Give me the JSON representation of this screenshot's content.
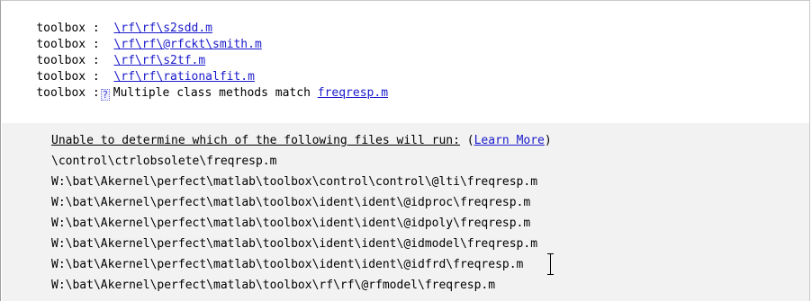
{
  "results": [
    {
      "label": "toolbox :",
      "sep": "  ",
      "path": "\\rf\\rf\\s2sdd.m"
    },
    {
      "label": "toolbox :",
      "sep": "  ",
      "path": "\\rf\\rf\\@rfckt\\smith.m"
    },
    {
      "label": "toolbox :",
      "sep": "  ",
      "path": "\\rf\\rf\\s2tf.m"
    },
    {
      "label": "toolbox :",
      "sep": "  ",
      "path": "\\rf\\rf\\rationalfit.m"
    }
  ],
  "multi": {
    "label": "toolbox :",
    "icon": "question-icon",
    "icon_glyph": "?",
    "message": "Multiple class methods match",
    "link": "freqresp.m"
  },
  "details": {
    "header": "Unable to determine which of the following files will run:",
    "learn_more_open": "(",
    "learn_more_label": "Learn More",
    "learn_more_close": ")",
    "files": [
      "\\control\\ctrlobsolete\\freqresp.m",
      "W:\\bat\\Akernel\\perfect\\matlab\\toolbox\\control\\control\\@lti\\freqresp.m",
      "W:\\bat\\Akernel\\perfect\\matlab\\toolbox\\ident\\ident\\@idproc\\freqresp.m",
      "W:\\bat\\Akernel\\perfect\\matlab\\toolbox\\ident\\ident\\@idpoly\\freqresp.m",
      "W:\\bat\\Akernel\\perfect\\matlab\\toolbox\\ident\\ident\\@idmodel\\freqresp.m",
      "W:\\bat\\Akernel\\perfect\\matlab\\toolbox\\ident\\ident\\@idfrd\\freqresp.m",
      "W:\\bat\\Akernel\\perfect\\matlab\\toolbox\\rf\\rf\\@rfmodel\\freqresp.m"
    ]
  },
  "colors": {
    "link": "#1a1acc",
    "details_background": "#f2f2f2"
  }
}
